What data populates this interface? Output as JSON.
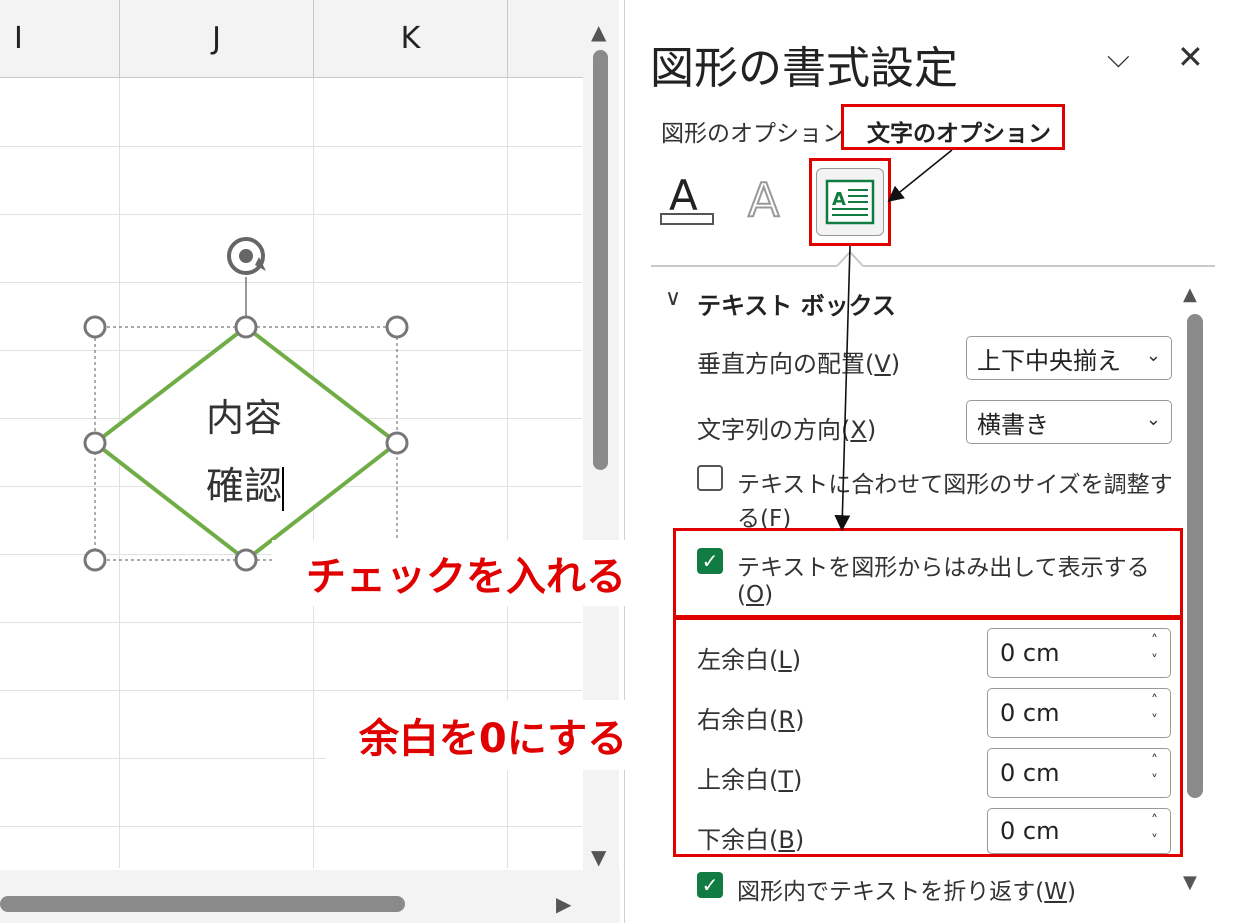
{
  "sheet": {
    "columns": [
      "I",
      "J",
      "K"
    ],
    "shape_text_line1": "内容",
    "shape_text_line2": "確認"
  },
  "panel": {
    "title": "図形の書式設定",
    "tabs": [
      {
        "label": "図形のオプション"
      },
      {
        "label": "文字のオプション",
        "selected": true
      }
    ],
    "section_title": "テキスト ボックス",
    "vertical_align_label": "垂直方向の配置(",
    "vertical_align_key": "V",
    "vertical_align_value": "上下中央揃え",
    "text_direction_label": "文字列の方向(",
    "text_direction_key": "X",
    "text_direction_value": "横書き",
    "autofit_label": "テキストに合わせて図形のサイズを調整す",
    "autofit_label2": "る(",
    "autofit_key": "F",
    "autofit_checked": false,
    "overflow_label": "テキストを図形からはみ出して表示する",
    "overflow_label2": "(",
    "overflow_key": "O",
    "overflow_checked": true,
    "margins": [
      {
        "label": "左余白(",
        "key": "L",
        "value": "0 cm"
      },
      {
        "label": "右余白(",
        "key": "R",
        "value": "0 cm"
      },
      {
        "label": "上余白(",
        "key": "T",
        "value": "0 cm"
      },
      {
        "label": "下余白(",
        "key": "B",
        "value": "0 cm"
      }
    ],
    "wrap_label": "図形内でテキストを折り返す(",
    "wrap_key": "W",
    "wrap_checked": true
  },
  "callouts": {
    "check": "チェックを入れる",
    "margin": "余白を0にする"
  },
  "colors": {
    "accent_red": "#e00000",
    "check_green": "#107c41",
    "shape_green": "#70ad47"
  }
}
